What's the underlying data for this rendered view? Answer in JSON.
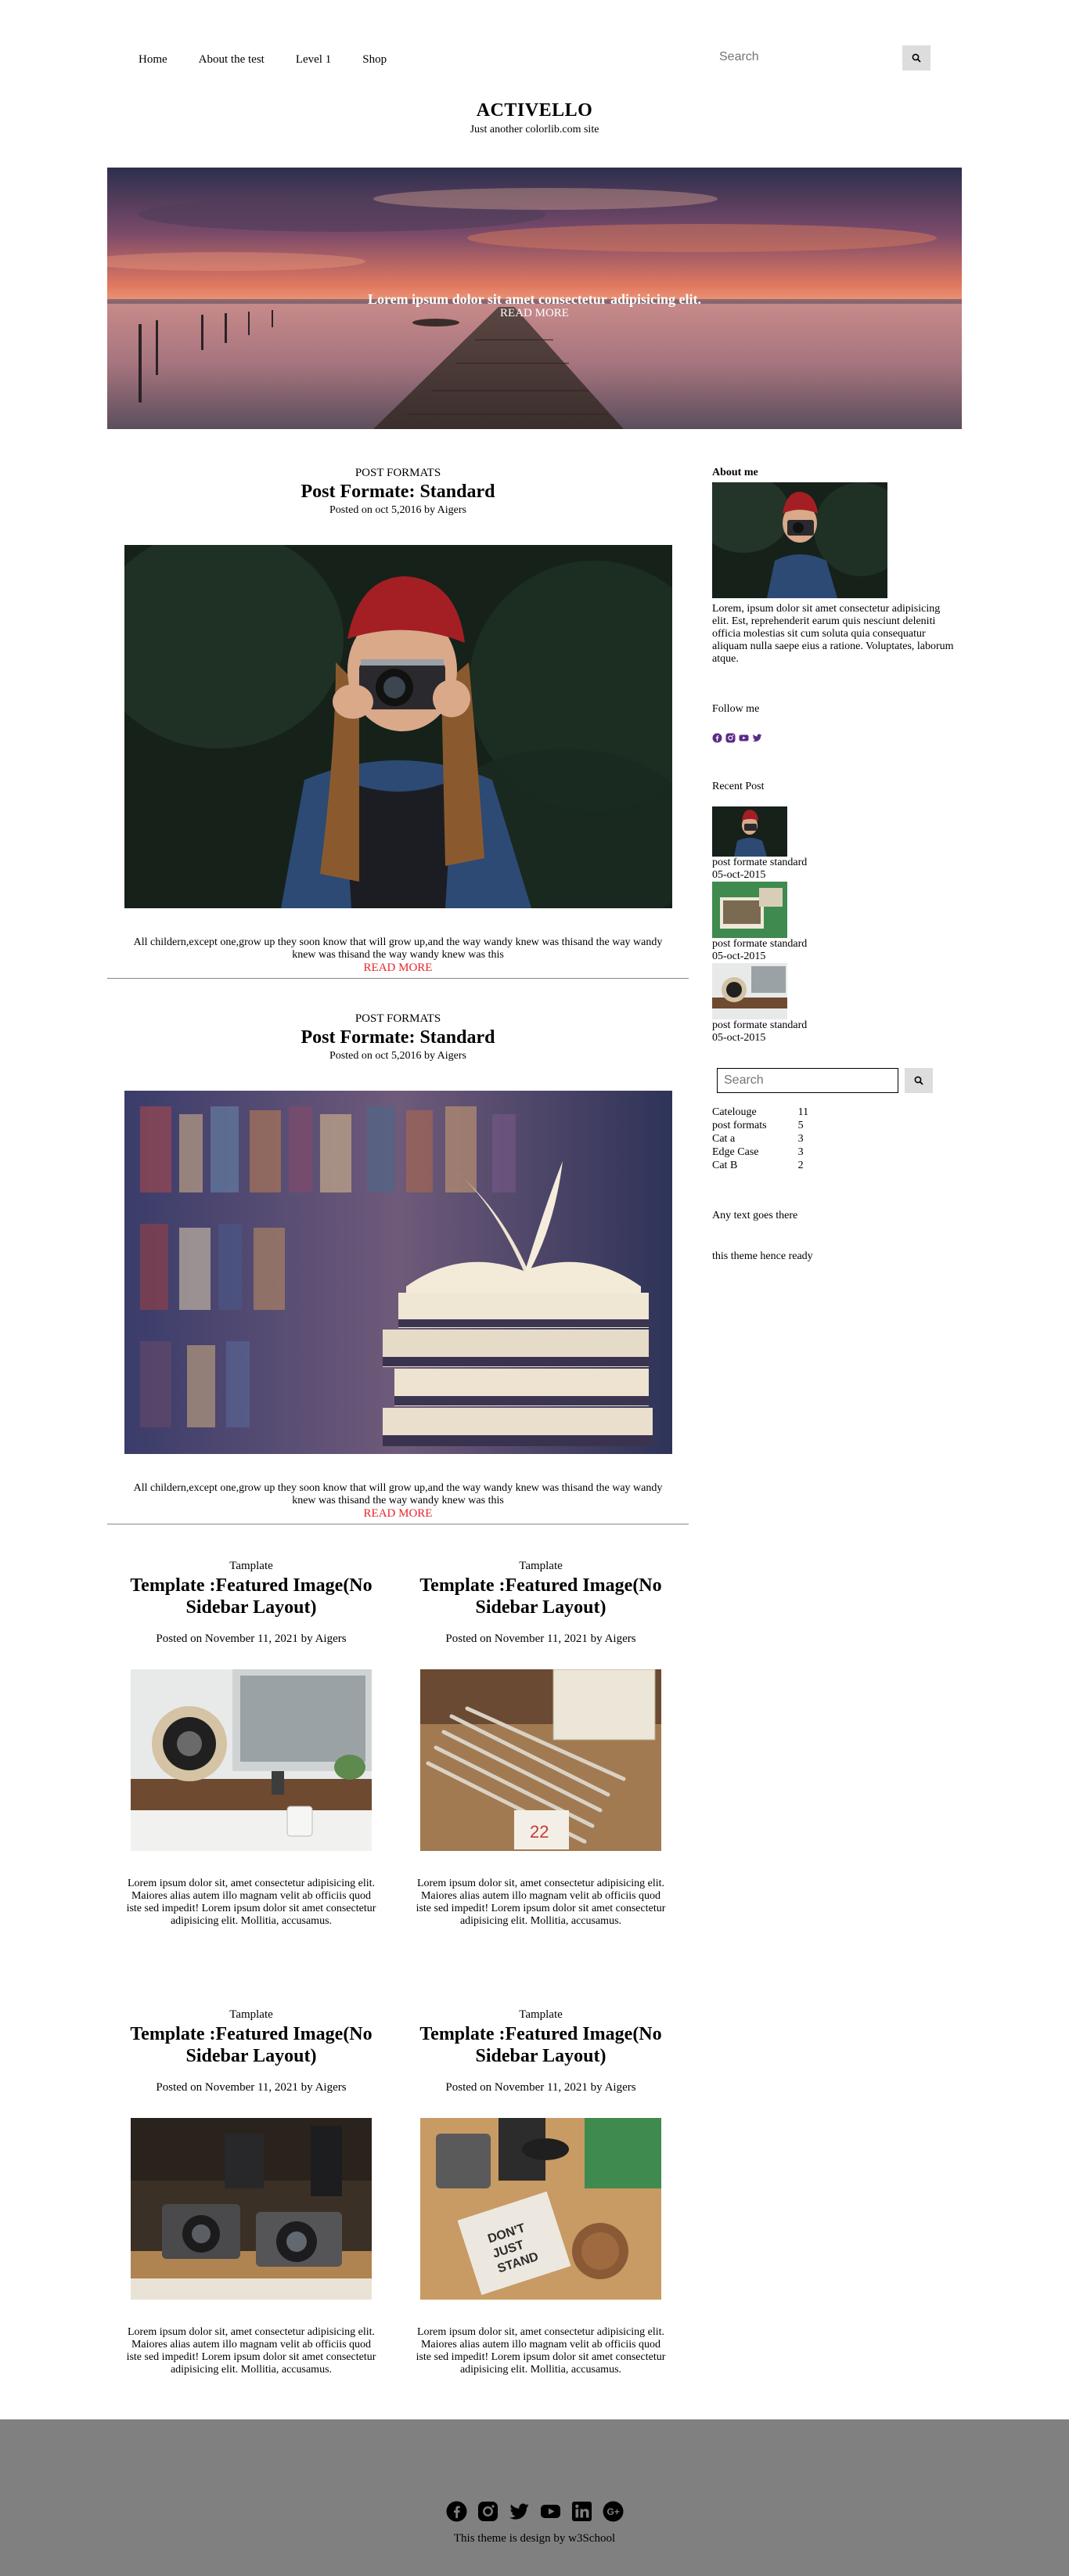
{
  "nav": {
    "links": [
      "Home",
      "About the test",
      "Level 1",
      "Shop"
    ],
    "search_placeholder": "Search"
  },
  "header": {
    "title": "ACTIVELLO",
    "description": "Just another colorlib.com site"
  },
  "hero": {
    "caption": "Lorem ipsum dolor sit amet consectetur adipisicing elit.",
    "read_more": "READ MORE"
  },
  "posts": [
    {
      "category": "POST FORMATS",
      "title": "Post Formate: Standard",
      "meta": "Posted on oct 5,2016 by Aigers",
      "excerpt": "All childern,except one,grow up they soon know that will grow up,and the way wandy knew was thisand the way wandy knew was thisand the way wandy knew was this",
      "read_more": "READ MORE"
    },
    {
      "category": "POST FORMATS",
      "title": "Post Formate: Standard",
      "meta": "Posted on oct 5,2016 by Aigers",
      "excerpt": "All childern,except one,grow up they soon know that will grow up,and the way wandy knew was thisand the way wandy knew was thisand the way wandy knew was this",
      "read_more": "READ MORE"
    }
  ],
  "grid_posts": [
    {
      "category": "Tamplate",
      "title": "Template :Featured Image(No Sidebar Layout)",
      "meta": "Posted on November 11, 2021 by Aigers",
      "text": "Lorem ipsum dolor sit, amet consectetur adipisicing elit. Maiores alias autem illo magnam velit ab officiis quod iste sed impedit! Lorem ipsum dolor sit amet consectetur adipisicing elit. Mollitia, accusamus."
    },
    {
      "category": "Tamplate",
      "title": "Template :Featured Image(No Sidebar Layout)",
      "meta": "Posted on November 11, 2021 by Aigers",
      "text": "Lorem ipsum dolor sit, amet consectetur adipisicing elit. Maiores alias autem illo magnam velit ab officiis quod iste sed impedit! Lorem ipsum dolor sit amet consectetur adipisicing elit. Mollitia, accusamus."
    },
    {
      "category": "Tamplate",
      "title": "Template :Featured Image(No Sidebar Layout)",
      "meta": "Posted on November 11, 2021 by Aigers",
      "text": "Lorem ipsum dolor sit, amet consectetur adipisicing elit. Maiores alias autem illo magnam velit ab officiis quod iste sed impedit! Lorem ipsum dolor sit amet consectetur adipisicing elit. Mollitia, accusamus."
    },
    {
      "category": "Tamplate",
      "title": "Template :Featured Image(No Sidebar Layout)",
      "meta": "Posted on November 11, 2021 by Aigers",
      "text": "Lorem ipsum dolor sit, amet consectetur adipisicing elit. Maiores alias autem illo magnam velit ab officiis quod iste sed impedit! Lorem ipsum dolor sit amet consectetur adipisicing elit. Mollitia, accusamus."
    }
  ],
  "sidebar": {
    "about_heading": "About me",
    "about_text": "Lorem, ipsum dolor sit amet consectetur adipisicing elit. Est, reprehenderit earum quis nesciunt deleniti officia molestias sit cum soluta quia consequatur aliquam nulla saepe eius a ratione. Voluptates, laborum atque.",
    "follow_heading": "Follow me",
    "follow_icons": [
      "facebook-icon",
      "instagram-icon",
      "youtube-icon",
      "twitter-icon"
    ],
    "follow_color": "#5b2a86",
    "recent_heading": "Recent Post",
    "recent": [
      {
        "title": "post formate standard",
        "date": "05-oct-2015"
      },
      {
        "title": "post formate standard",
        "date": "05-oct-2015"
      },
      {
        "title": "post formate standard",
        "date": "05-oct-2015"
      }
    ],
    "search_placeholder": "Search",
    "categories": [
      {
        "name": "Catelouge",
        "count": "11"
      },
      {
        "name": "post formats",
        "count": "5"
      },
      {
        "name": "Cat a",
        "count": "3"
      },
      {
        "name": "Edge Case",
        "count": "3"
      },
      {
        "name": "Cat B",
        "count": "2"
      }
    ],
    "text1": "Any text goes there",
    "text2": "this theme hence ready"
  },
  "footer": {
    "icons": [
      "facebook-icon",
      "instagram-icon",
      "twitter-icon",
      "youtube-icon",
      "linkedin-icon",
      "google-plus-icon"
    ],
    "credit": "This theme is design by w3School",
    "background": "#808080"
  },
  "colors": {
    "read_more": "#e8232b",
    "search_button": "#dddddd"
  }
}
